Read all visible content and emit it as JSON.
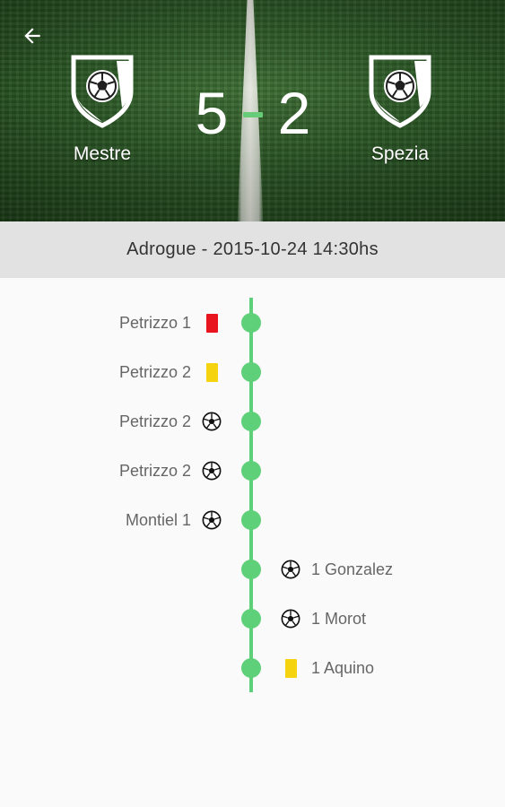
{
  "match": {
    "home_team": "Mestre",
    "away_team": "Spezia",
    "home_score": "5",
    "away_score": "2",
    "info": "Adrogue - 2015-10-24 14:30hs"
  },
  "colors": {
    "accent": "#5fd07a",
    "red_card": "#e8141e",
    "yellow_card": "#f5d40f",
    "info_bar": "#e2e2e2"
  },
  "events": [
    {
      "side": "home",
      "type": "red-card",
      "text": "Petrizzo 1"
    },
    {
      "side": "home",
      "type": "yellow-card",
      "text": "Petrizzo 2"
    },
    {
      "side": "home",
      "type": "goal",
      "text": "Petrizzo 2"
    },
    {
      "side": "home",
      "type": "goal",
      "text": "Petrizzo 2"
    },
    {
      "side": "home",
      "type": "goal",
      "text": "Montiel 1"
    },
    {
      "side": "away",
      "type": "goal",
      "text": "1 Gonzalez"
    },
    {
      "side": "away",
      "type": "goal",
      "text": "1 Morot"
    },
    {
      "side": "away",
      "type": "yellow-card",
      "text": "1 Aquino"
    }
  ]
}
